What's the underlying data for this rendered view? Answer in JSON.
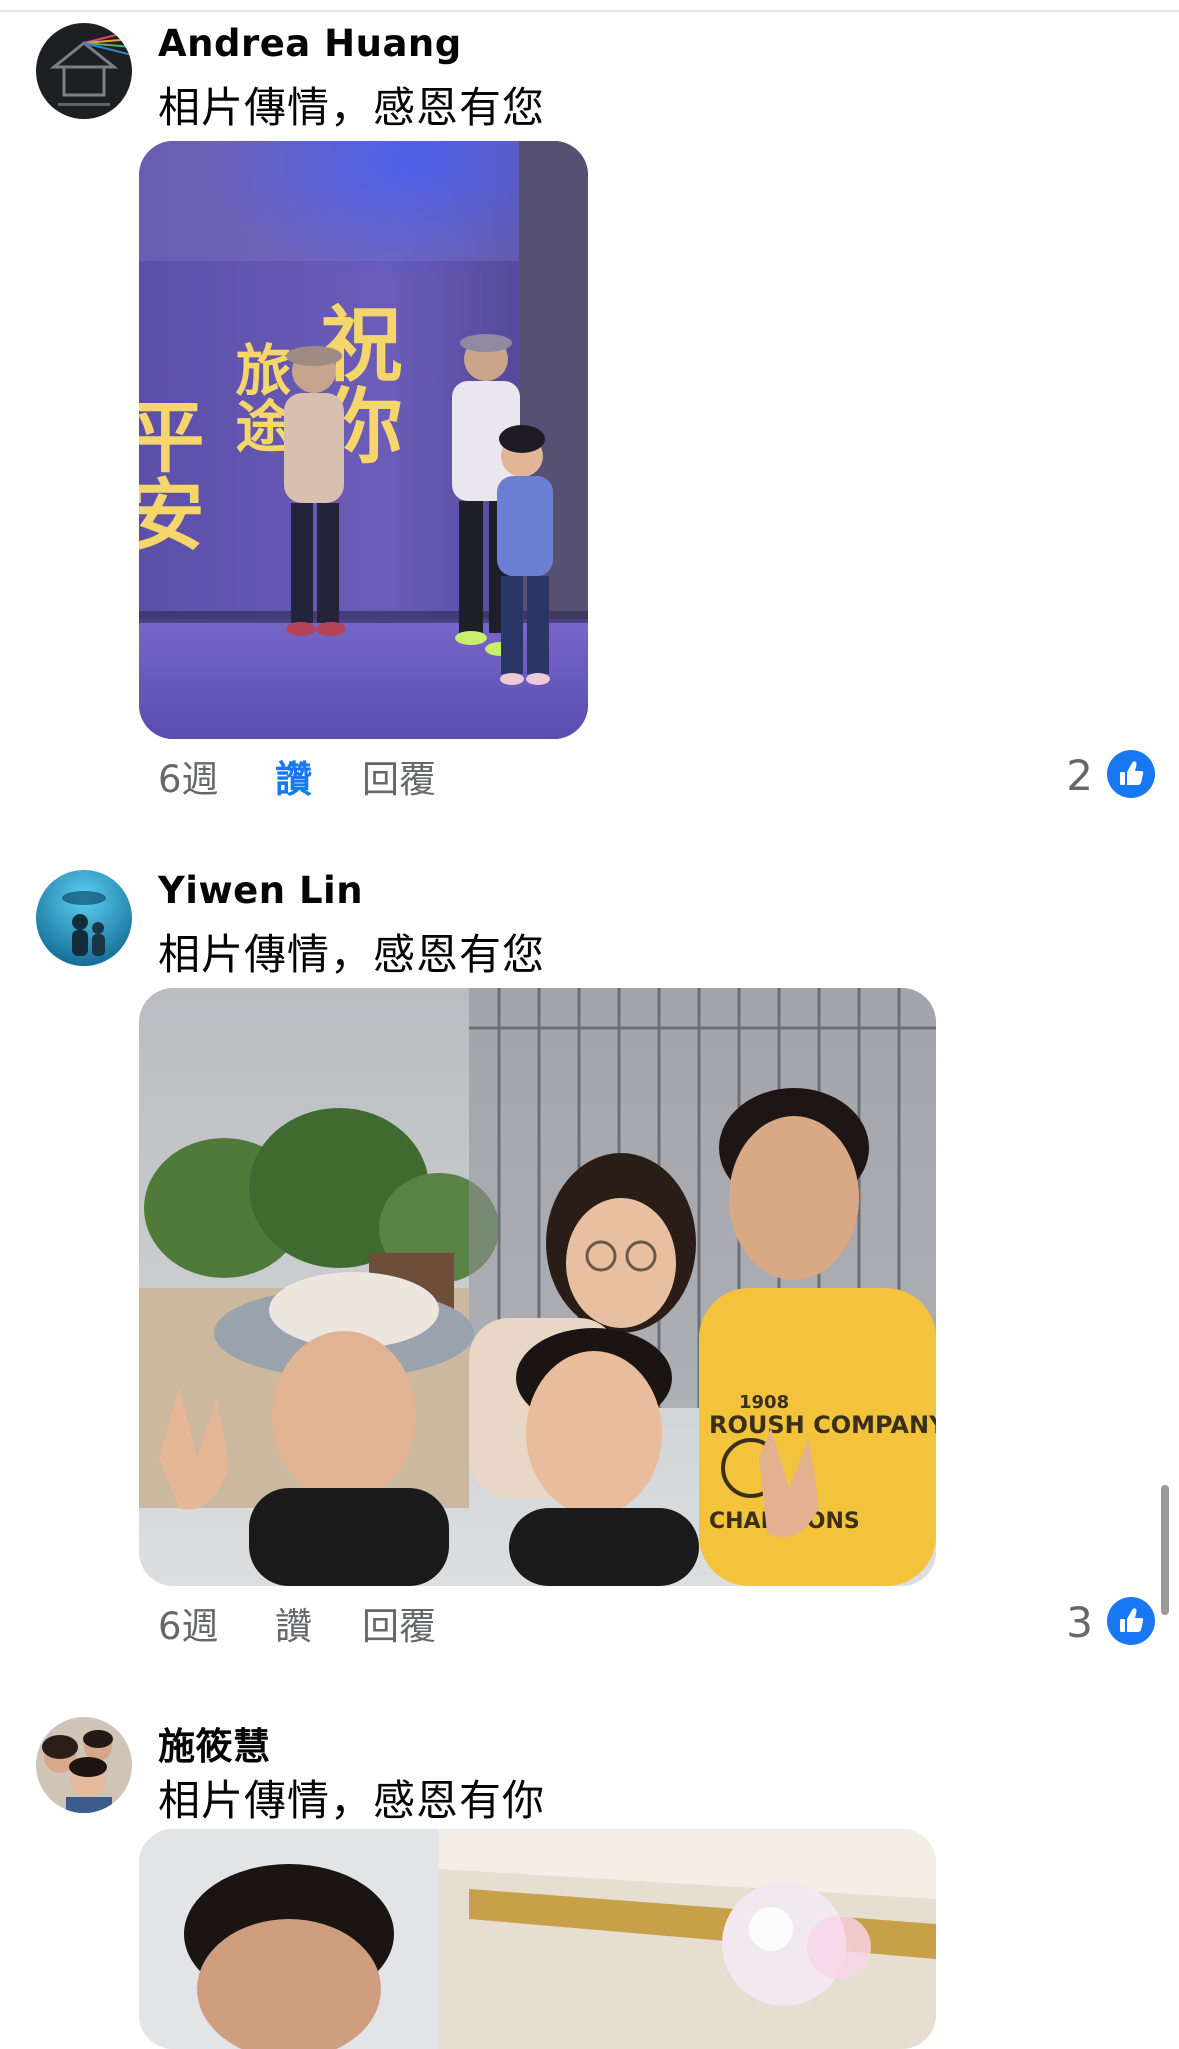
{
  "comments": [
    {
      "author": "Andrea Huang",
      "text": "相片傳情，感恩有您",
      "time": "6週",
      "like_label": "讚",
      "reply_label": "回覆",
      "reaction_count": "2",
      "liked": true
    },
    {
      "author": "Yiwen Lin",
      "text": "相片傳情，感恩有您",
      "time": "6週",
      "like_label": "讚",
      "reply_label": "回覆",
      "reaction_count": "3",
      "liked": false
    },
    {
      "author": "施筱慧",
      "text": "相片傳情，感恩有你"
    }
  ],
  "photo1": {
    "calligraphy_left": "平安",
    "calligraphy_mid": "旅途",
    "calligraphy_right": "祝你"
  },
  "photo2": {
    "shirt_line1": "1908",
    "shirt_line2": "ROUSH COMPANY",
    "shirt_line3": "CHAMPIONS"
  },
  "colors": {
    "accent": "#1877f2",
    "meta_text": "#65676b",
    "author_text": "#050505"
  },
  "icons": {
    "like": "thumbs-up-icon"
  }
}
